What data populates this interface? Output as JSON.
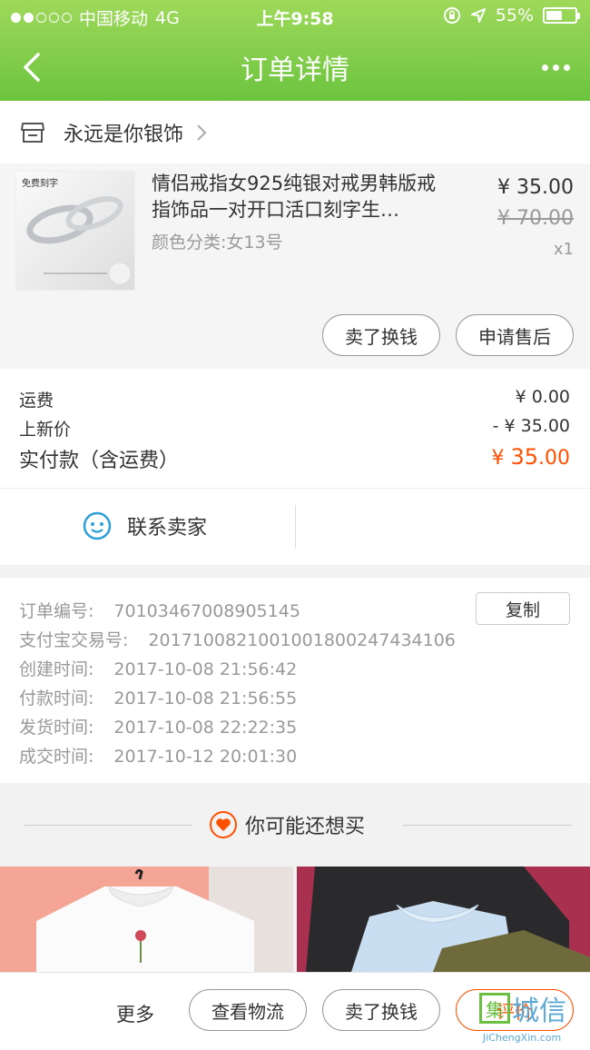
{
  "status_bar": {
    "carrier": "中国移动",
    "network": "4G",
    "time": "上午9:58",
    "battery": "55%",
    "battery_level": 0.55,
    "signal_bars": 2
  },
  "nav": {
    "title": "订单详情"
  },
  "shop": {
    "name": "永远是你银饰"
  },
  "item": {
    "title": "情侣戒指女925纯银对戒男韩版戒指饰品一对开口活口刻字生…",
    "spec": "颜色分类:女13号",
    "price": "¥ 35.00",
    "original_price": "¥ 70.00",
    "quantity": "x1",
    "image_badge": "免费刻字",
    "buttons": {
      "sell": "卖了换钱",
      "after_sale": "申请售后"
    }
  },
  "fees": {
    "shipping_label": "运费",
    "shipping_value": "¥ 0.00",
    "new_price_label": "上新价",
    "new_price_value": "- ¥ 35.00",
    "paid_label": "实付款（含运费）",
    "paid_currency": "¥",
    "paid_int": "35",
    "paid_dec": ".00"
  },
  "contact": {
    "label": "联系卖家"
  },
  "order_info": {
    "copy_label": "复制",
    "rows": [
      {
        "label": "订单编号:",
        "value": "70103467008905145"
      },
      {
        "label": "支付宝交易号:",
        "value": "2017100821001001800247434106"
      },
      {
        "label": "创建时间:",
        "value": "2017-10-08 21:56:42"
      },
      {
        "label": "付款时间:",
        "value": "2017-10-08 21:56:55"
      },
      {
        "label": "发货时间:",
        "value": "2017-10-08 22:22:35"
      },
      {
        "label": "成交时间:",
        "value": "2017-10-12 20:01:30"
      }
    ]
  },
  "recommend": {
    "title": "你可能还想买"
  },
  "bottom_bar": {
    "more": "更多",
    "logistics": "查看物流",
    "sell": "卖了换钱",
    "rate": "评价"
  },
  "watermark": {
    "logo_box": "集",
    "logo_text": "城信",
    "sub": "JiChengXin.com"
  },
  "colors": {
    "header_green": "#6cc43f",
    "accent_orange": "#ff5000",
    "contact_blue": "#2a9fd8"
  }
}
